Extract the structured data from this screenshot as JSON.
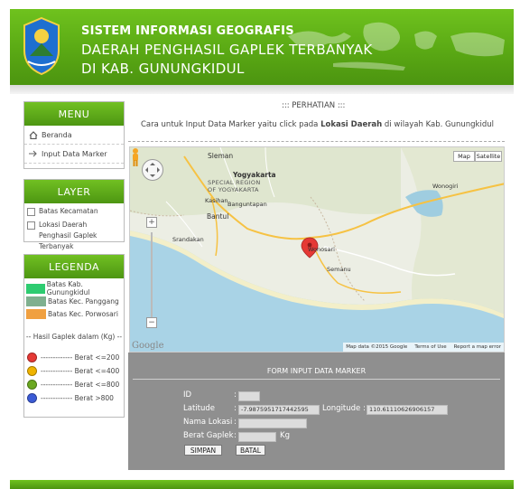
{
  "header": {
    "title1": "SISTEM INFORMASI GEOGRAFIS",
    "title2": "DAERAH PENGHASIL GAPLEK TERBANYAK",
    "title3": "DI KAB. GUNUNGKIDUL"
  },
  "menu": {
    "title": "MENU",
    "items": [
      {
        "label": "Beranda",
        "icon": "home-icon"
      },
      {
        "label": "Input Data Marker",
        "icon": "arrow-right-icon"
      }
    ]
  },
  "layer": {
    "title": "LAYER",
    "items": [
      {
        "label": "Batas Kecamatan",
        "checked": false
      },
      {
        "label": "Lokasi Daerah Penghasil Gaplek Terbanyak",
        "checked": false
      }
    ]
  },
  "legenda": {
    "title": "LEGENDA",
    "areas": [
      {
        "label": "Batas Kab. Gunungkidul",
        "color": "#2ecc71"
      },
      {
        "label": "Batas Kec. Panggang",
        "color": "#7fb08f"
      },
      {
        "label": "Batas Kec. Porwosari",
        "color": "#f0a040"
      }
    ],
    "hasil_label": "-- Hasil Gaplek dalam (Kg) --",
    "berat": [
      {
        "label": "------------- Berat <=200",
        "color": "#e53935"
      },
      {
        "label": "------------- Berat <=400",
        "color": "#f0b400"
      },
      {
        "label": "------------- Berat <=800",
        "color": "#6aa820"
      },
      {
        "label": "------------- Berat >800",
        "color": "#3b5bd6"
      }
    ]
  },
  "main": {
    "perhatian": "::: PERHATIAN :::",
    "instruksi_pre": "Cara untuk Input Data Marker  yaitu click pada ",
    "instruksi_bold": "Lokasi Daerah",
    "instruksi_post": " di wilayah Kab. Gunungkidul"
  },
  "map": {
    "type_map": "Map",
    "type_satellite": "Satellite",
    "labels": {
      "sleman": "Sleman",
      "special_region1": "SPECIAL REGION",
      "special_region2": "OF YOGYAKARTA",
      "yogyakarta": "Yogyakarta",
      "kasihan": "Kasihan",
      "banguntapan": "Banguntapan",
      "bantul": "Bantul",
      "srandakan": "Srandakan",
      "wonosari": "Wonosari",
      "semanu": "Semanu",
      "wonogiri": "Wonogiri"
    },
    "pan_label": "< >",
    "zoom_in": "+",
    "zoom_out": "−",
    "google": "Google",
    "footer": [
      "Map data ©2015 Google",
      "Terms of Use",
      "Report a map error"
    ],
    "marker_color": "#e53935"
  },
  "form": {
    "title": "FORM INPUT DATA MARKER",
    "id_label": "ID",
    "id_value": "",
    "lat_label": "Latitude",
    "lat_value": "-7.9875951717442595",
    "lng_label": "Longitude",
    "lng_value": "110.61110626906157",
    "nama_label": "Nama Lokasi",
    "nama_value": "",
    "berat_label": "Berat Gaplek",
    "berat_value": "",
    "berat_unit": "Kg",
    "simpan": "SIMPAN",
    "batal": "BATAL",
    "colon": ":"
  }
}
